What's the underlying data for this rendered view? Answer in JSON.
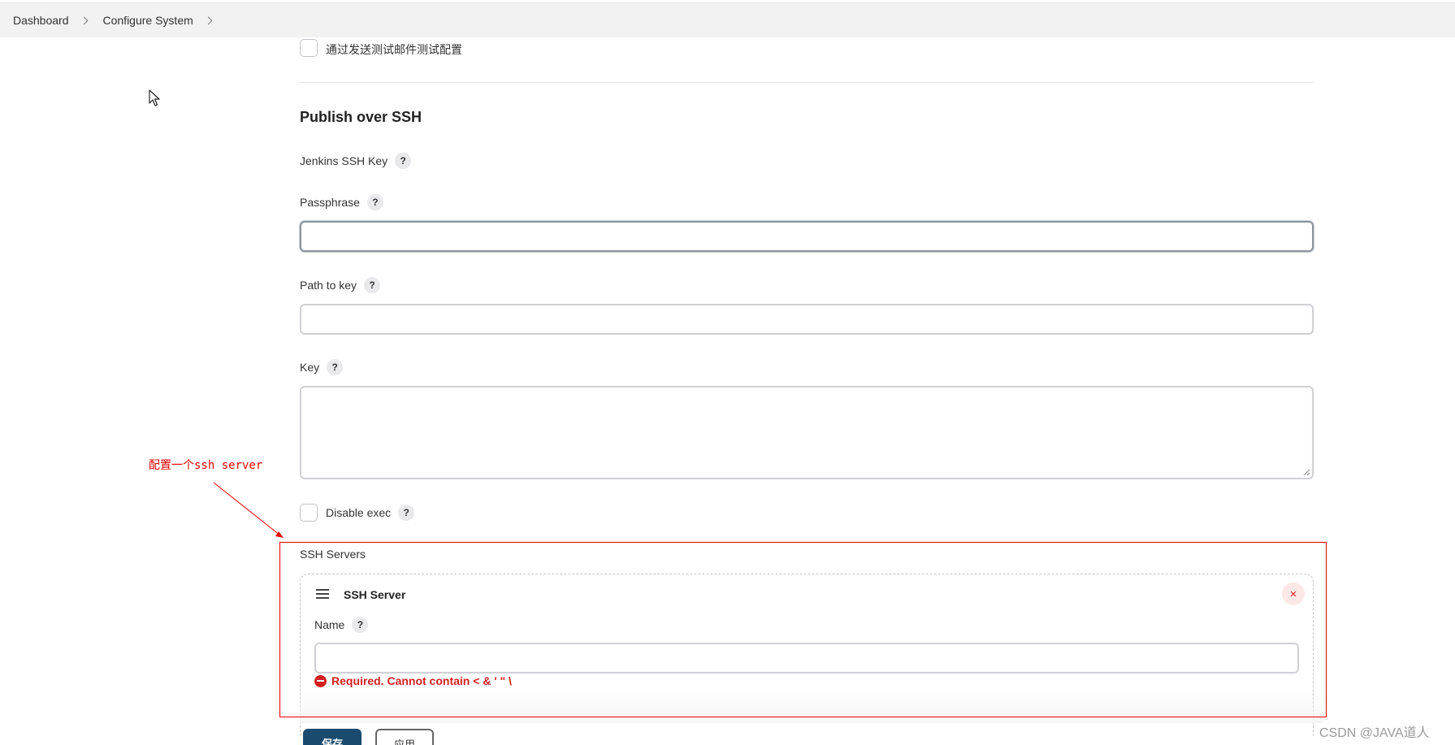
{
  "breadcrumb": {
    "items": [
      "Dashboard",
      "Configure System"
    ]
  },
  "test_mail_checkbox": {
    "label": "通过发送测试邮件测试配置"
  },
  "section": {
    "title": "Publish over SSH"
  },
  "fields": {
    "jenkins_ssh_key": {
      "label": "Jenkins SSH Key"
    },
    "passphrase": {
      "label": "Passphrase",
      "value": ""
    },
    "path_to_key": {
      "label": "Path to key",
      "value": ""
    },
    "key": {
      "label": "Key",
      "value": ""
    },
    "disable_exec": {
      "label": "Disable exec",
      "checked": false
    }
  },
  "help_glyph": "?",
  "ssh_servers": {
    "label": "SSH Servers",
    "server": {
      "title": "SSH Server",
      "remove_glyph": "×",
      "name_label": "Name",
      "name_value": "",
      "error": "Required. Cannot contain < & ' \" \\"
    }
  },
  "annotation": {
    "text": "配置一个ssh server",
    "color": "#e60000"
  },
  "buttons": {
    "save": "保存",
    "apply": "应用"
  },
  "watermark": "CSDN @JAVA道人",
  "colors": {
    "primary_button": "#1a4b6e",
    "error": "#d21f1f"
  }
}
